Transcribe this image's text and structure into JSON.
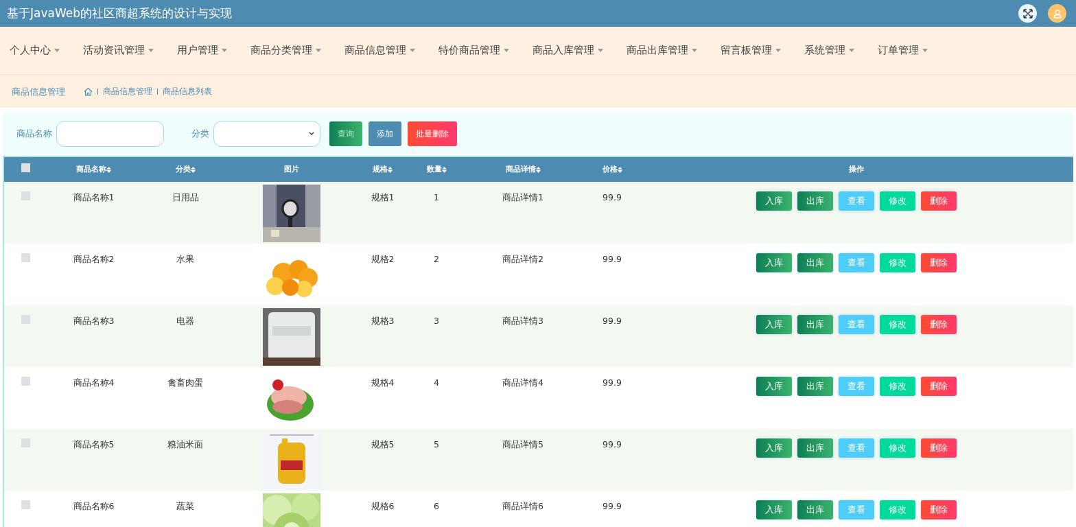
{
  "header": {
    "title": "基于JavaWeb的社区商超系统的设计与实现"
  },
  "nav": [
    {
      "label": "个人中心"
    },
    {
      "label": "活动资讯管理"
    },
    {
      "label": "用户管理"
    },
    {
      "label": "商品分类管理"
    },
    {
      "label": "商品信息管理"
    },
    {
      "label": "特价商品管理"
    },
    {
      "label": "商品入库管理"
    },
    {
      "label": "商品出库管理"
    },
    {
      "label": "留言板管理"
    },
    {
      "label": "系统管理"
    },
    {
      "label": "订单管理"
    }
  ],
  "breadcrumb": {
    "title": "商品信息管理",
    "path": [
      "商品信息管理",
      "商品信息列表"
    ]
  },
  "search": {
    "fields": [
      {
        "label": "商品名称",
        "kind": "text"
      },
      {
        "label": "分类",
        "kind": "select"
      }
    ],
    "buttons": [
      {
        "label": "查询",
        "kind": "query"
      },
      {
        "label": "添加",
        "kind": "add"
      },
      {
        "label": "批量删除",
        "kind": "delete"
      }
    ]
  },
  "table": {
    "select_all": {
      "checked": false
    },
    "columns": [
      {
        "label": "商品名称",
        "sortable": true
      },
      {
        "label": "分类",
        "sortable": true
      },
      {
        "label": "图片",
        "sortable": false
      },
      {
        "label": "规格",
        "sortable": true
      },
      {
        "label": "数量",
        "sortable": true
      },
      {
        "label": "商品详情",
        "sortable": true
      },
      {
        "label": "价格",
        "sortable": true
      },
      {
        "label": "操作",
        "sortable": false
      }
    ],
    "rows": [
      {
        "checked": false,
        "cells": [
          "商品名称1",
          "日用品",
          {
            "kind": "picture"
          },
          "规格1",
          "1",
          "商品详情1",
          "99.9"
        ],
        "actions": [
          {
            "label": "入库",
            "kind": "in"
          },
          {
            "label": "出库",
            "kind": "out"
          },
          {
            "label": "查看",
            "kind": "view"
          },
          {
            "label": "修改",
            "kind": "edit"
          },
          {
            "label": "删除",
            "kind": "delete"
          }
        ]
      },
      {
        "checked": false,
        "cells": [
          "商品名称2",
          "水果",
          {
            "kind": "picture"
          },
          "规格2",
          "2",
          "商品详情2",
          "99.9"
        ],
        "actions": [
          {
            "label": "入库",
            "kind": "in"
          },
          {
            "label": "出库",
            "kind": "out"
          },
          {
            "label": "查看",
            "kind": "view"
          },
          {
            "label": "修改",
            "kind": "edit"
          },
          {
            "label": "删除",
            "kind": "delete"
          }
        ]
      },
      {
        "checked": false,
        "cells": [
          "商品名称3",
          "电器",
          {
            "kind": "picture"
          },
          "规格3",
          "3",
          "商品详情3",
          "99.9"
        ],
        "actions": [
          {
            "label": "入库",
            "kind": "in"
          },
          {
            "label": "出库",
            "kind": "out"
          },
          {
            "label": "查看",
            "kind": "view"
          },
          {
            "label": "修改",
            "kind": "edit"
          },
          {
            "label": "删除",
            "kind": "delete"
          }
        ]
      },
      {
        "checked": false,
        "cells": [
          "商品名称4",
          "禽畜肉蛋",
          {
            "kind": "picture"
          },
          "规格4",
          "4",
          "商品详情4",
          "99.9"
        ],
        "actions": [
          {
            "label": "入库",
            "kind": "in"
          },
          {
            "label": "出库",
            "kind": "out"
          },
          {
            "label": "查看",
            "kind": "view"
          },
          {
            "label": "修改",
            "kind": "edit"
          },
          {
            "label": "删除",
            "kind": "delete"
          }
        ]
      },
      {
        "checked": false,
        "cells": [
          "商品名称5",
          "粮油米面",
          {
            "kind": "picture"
          },
          "规格5",
          "5",
          "商品详情5",
          "99.9"
        ],
        "actions": [
          {
            "label": "入库",
            "kind": "in"
          },
          {
            "label": "出库",
            "kind": "out"
          },
          {
            "label": "查看",
            "kind": "view"
          },
          {
            "label": "修改",
            "kind": "edit"
          },
          {
            "label": "删除",
            "kind": "delete"
          }
        ]
      },
      {
        "checked": false,
        "cells": [
          "商品名称6",
          "蔬菜",
          {
            "kind": "picture"
          },
          "规格6",
          "6",
          "商品详情6",
          "99.9"
        ],
        "actions": [
          {
            "label": "入库",
            "kind": "in"
          },
          {
            "label": "出库",
            "kind": "out"
          },
          {
            "label": "查看",
            "kind": "view"
          },
          {
            "label": "修改",
            "kind": "edit"
          },
          {
            "label": "删除",
            "kind": "delete"
          }
        ]
      }
    ]
  }
}
